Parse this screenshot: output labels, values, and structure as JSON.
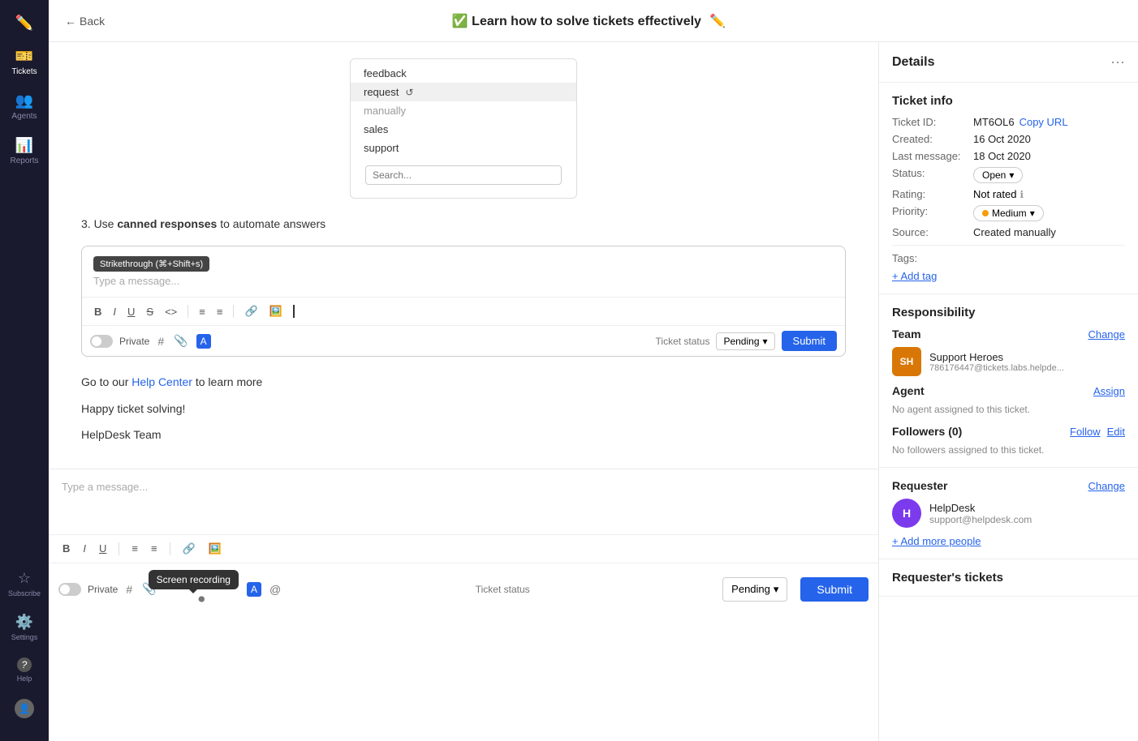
{
  "sidebar": {
    "items": [
      {
        "id": "edit",
        "label": "",
        "icon": "✏️",
        "active": false
      },
      {
        "id": "tickets",
        "label": "Tickets",
        "icon": "🎫",
        "active": true
      },
      {
        "id": "agents",
        "label": "Agents",
        "icon": "👥",
        "active": false
      },
      {
        "id": "reports",
        "label": "Reports",
        "icon": "📊",
        "active": false
      }
    ],
    "bottom_items": [
      {
        "id": "subscribe",
        "label": "Subscribe",
        "icon": "☆"
      },
      {
        "id": "settings",
        "label": "Settings",
        "icon": "⚙️"
      },
      {
        "id": "help",
        "label": "Help",
        "icon": "?"
      },
      {
        "id": "user",
        "label": "",
        "icon": "👤"
      }
    ]
  },
  "topbar": {
    "back_label": "Back",
    "title": "✅ Learn how to solve tickets effectively",
    "edit_icon": "✏️"
  },
  "ticket_body": {
    "dropdown_items": [
      "feedback",
      "request",
      "sales",
      "support"
    ],
    "dropdown_search_placeholder": "Search...",
    "dropdown_selected": "request",
    "manually_label": "manually",
    "step3_text": "3. Use",
    "step3_bold": "canned responses",
    "step3_suffix": "to automate answers",
    "composer_placeholder": "Type a message...",
    "strikethrough_tooltip": "Strikethrough (⌘+Shift+s)",
    "toolbar_buttons": [
      "B",
      "I",
      "U",
      "S",
      "<>",
      "≡",
      "≡"
    ],
    "private_label": "Private",
    "ticket_status_label": "Ticket status",
    "status_pending": "Pending",
    "submit_label": "Submit",
    "helptext_prefix": "Go to our",
    "helptext_link": "Help Center",
    "helptext_suffix": "to learn more",
    "happy_solving": "Happy ticket solving!",
    "signature": "HelpDesk Team"
  },
  "bottom_composer": {
    "placeholder": "Type a message...",
    "screen_recording_tooltip": "Screen recording",
    "ticket_status_label": "Ticket status",
    "status_pending": "Pending",
    "submit_label": "Submit"
  },
  "details_panel": {
    "title": "Details",
    "more_icon": "···",
    "ticket_info": {
      "title": "Ticket info",
      "ticket_id_label": "Ticket ID:",
      "ticket_id_value": "MT6OL6",
      "copy_url_label": "Copy URL",
      "created_label": "Created:",
      "created_value": "16 Oct 2020",
      "last_message_label": "Last message:",
      "last_message_value": "18 Oct 2020",
      "status_label": "Status:",
      "status_value": "Open",
      "rating_label": "Rating:",
      "rating_value": "Not rated",
      "priority_label": "Priority:",
      "priority_value": "Medium",
      "source_label": "Source:",
      "source_value": "Created manually",
      "tags_label": "Tags:",
      "add_tag_label": "+ Add tag"
    },
    "responsibility": {
      "title": "Responsibility",
      "team_label": "Team",
      "change_label": "Change",
      "team_avatar": "SH",
      "team_name": "Support Heroes",
      "team_email": "786176447@tickets.labs.helpde...",
      "agent_label": "Agent",
      "assign_label": "Assign",
      "no_agent_text": "No agent assigned to this ticket.",
      "followers_label": "Followers (0)",
      "follow_label": "Follow",
      "edit_label": "Edit",
      "no_followers_text": "No followers assigned to this ticket."
    },
    "requester": {
      "title": "Requester",
      "change_label": "Change",
      "avatar_initials": "H",
      "name": "HelpDesk",
      "email": "support@helpdesk.com",
      "add_more_people": "+ Add more people"
    },
    "requester_tickets": {
      "title": "Requester's tickets"
    }
  }
}
